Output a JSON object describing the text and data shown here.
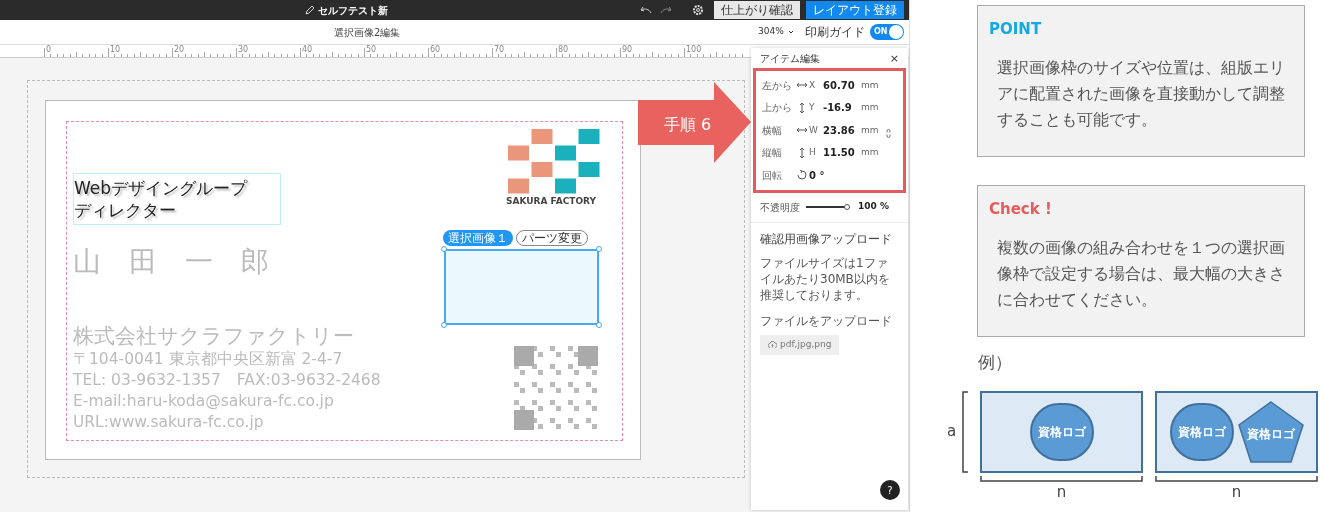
{
  "app_bar": {
    "title": "セルフテスト新",
    "buttons": [
      {
        "label": "仕上がり確認",
        "kind": "secondary"
      },
      {
        "label": "レイアウト登録",
        "kind": "primary"
      }
    ]
  },
  "toolbar": {
    "title": "選択画像2編集",
    "zoom": "304%",
    "print_guide": {
      "label": "印刷ガイド",
      "toggle_text": "ON",
      "on": true
    }
  },
  "ruler": {
    "labels": [
      "0",
      "10",
      "20",
      "30",
      "40",
      "50",
      "60",
      "70",
      "80",
      "90",
      "100"
    ]
  },
  "card": {
    "title_lines": [
      "Webデザイングループ",
      "ディレクター"
    ],
    "name": "山　田　一　郎",
    "company": "株式会社サクラファクトリー",
    "lines": [
      "〒104-0041 東京都中央区新富 2-4-7",
      "TEL: 03-9632-1357　FAX:03-9632-2468",
      "E-mail:haru-koda@sakura-fc.co.jp",
      "URL:www.sakura-fc.co.jp"
    ],
    "logo_text": "SAKURA FACTORY",
    "frame_tags": [
      {
        "label": "選択画像１",
        "selected": true
      },
      {
        "label": "パーツ変更",
        "selected": false
      }
    ]
  },
  "callout": {
    "label": "手順 6"
  },
  "panel": {
    "title": "アイテム編集",
    "close": "×",
    "fields": [
      {
        "label": "左から",
        "kind": "horizontal",
        "axis": "X",
        "value": "60.70",
        "unit": "mm"
      },
      {
        "label": "上から",
        "kind": "vertical",
        "axis": "Y",
        "value": "-16.9",
        "unit": "mm"
      },
      {
        "label": "横幅",
        "kind": "horizontal",
        "axis": "W",
        "value": "23.86",
        "unit": "mm"
      },
      {
        "label": "縦幅",
        "kind": "vertical",
        "axis": "H",
        "value": "11.50",
        "unit": "mm"
      },
      {
        "label": "回転",
        "kind": "rotate",
        "value": "0 °"
      }
    ],
    "opacity": {
      "label": "不透明度",
      "level": 0.93,
      "reading": "100 %"
    },
    "upload": {
      "title": "確認用画像アップロード",
      "note": "ファイルサイズは1ファイルあたり30MB以内を推奨しております。",
      "label": "ファイルをアップロード",
      "button": "pdf,jpg,png"
    },
    "help": "?"
  },
  "notes": [
    {
      "title": "POINT",
      "color": "#14a9e3",
      "text": "選択画像枠のサイズや位置は、組版エリアに配置された画像を直接動かして調整することも可能です。"
    },
    {
      "title": "Check !",
      "color": "#e45c5c",
      "text": "複数の画像の組み合わせを１つの選択画像枠で設定する場合は、最大幅の大きさに合わせてください。"
    }
  ],
  "example": {
    "title": "例）",
    "height_label": "a",
    "diagrams": [
      {
        "width_label": "n",
        "shapes": [
          {
            "kind": "circle",
            "label": "資格ロゴ"
          }
        ]
      },
      {
        "width_label": "n",
        "shapes": [
          {
            "kind": "circle",
            "label": "資格ロゴ"
          },
          {
            "kind": "pentagon",
            "label": "資格ロゴ"
          }
        ]
      }
    ]
  }
}
